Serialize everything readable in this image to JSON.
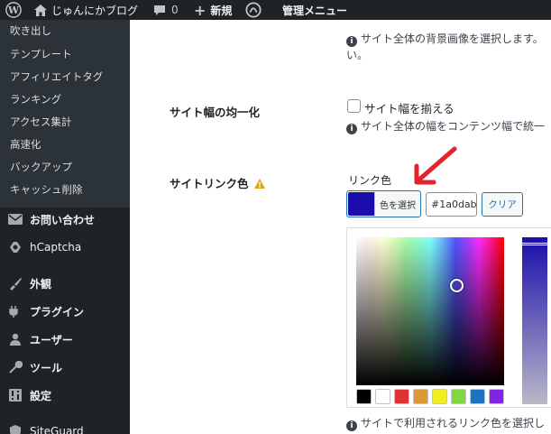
{
  "adminbar": {
    "site_name": "じゅんにかブログ",
    "comments_count": "0",
    "new_label": "新規",
    "admin_menu_label": "管理メニュー"
  },
  "sidebar": {
    "submenu": [
      "吹き出し",
      "テンプレート",
      "アフィリエイトタグ",
      "ランキング",
      "アクセス集計",
      "高速化",
      "バックアップ",
      "キャッシュ削除"
    ],
    "menu": [
      {
        "label": "お問い合わせ",
        "icon": "envelope-icon"
      },
      {
        "label": "hCaptcha",
        "icon": "hcaptcha-icon"
      },
      {
        "label": "外観",
        "icon": "appearance-icon"
      },
      {
        "label": "プラグイン",
        "icon": "plugin-icon"
      },
      {
        "label": "ユーザー",
        "icon": "user-icon"
      },
      {
        "label": "ツール",
        "icon": "wrench-icon"
      },
      {
        "label": "設定",
        "icon": "settings-icon"
      },
      {
        "label": "SiteGuard",
        "icon": "siteguard-icon"
      }
    ]
  },
  "content": {
    "bg_help": "サイト全体の背景画像を選択します。",
    "bg_help_cont": "い。",
    "width_row": {
      "label": "サイト幅の均一化",
      "checkbox_label": "サイト幅を揃える",
      "help": "サイト全体の幅をコンテンツ幅で統一"
    },
    "link_row": {
      "label": "サイトリンク色",
      "warning_icon": "warning-icon",
      "field_label": "リンク色",
      "select_button": "色を選択",
      "color_value": "#1a0dab",
      "clear_button": "クリア",
      "help": "サイトで利用されるリンク色を選択し"
    },
    "palette": [
      "#000000",
      "#ffffff",
      "#dd3333",
      "#dd9933",
      "#eeee22",
      "#81d742",
      "#1e73be",
      "#8224e3"
    ]
  },
  "colors": {
    "accent": "#2271b1",
    "link_color": "#1a0dab",
    "annotation_arrow": "#e2232a"
  }
}
